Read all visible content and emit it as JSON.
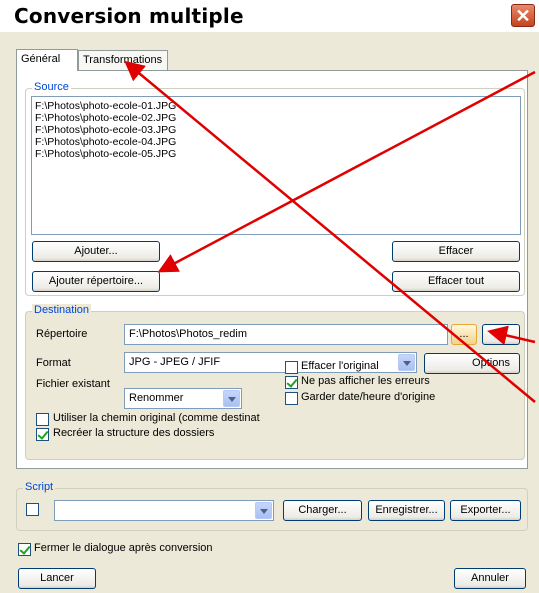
{
  "window": {
    "title": "Conversion multiple",
    "close_glyph": "✕"
  },
  "tabs": [
    {
      "label": "Général"
    },
    {
      "label": "Transformations"
    }
  ],
  "source": {
    "legend": "Source",
    "files": [
      "F:\\Photos\\photo-ecole-01.JPG",
      "F:\\Photos\\photo-ecole-02.JPG",
      "F:\\Photos\\photo-ecole-03.JPG",
      "F:\\Photos\\photo-ecole-04.JPG",
      "F:\\Photos\\photo-ecole-05.JPG"
    ],
    "add_label": "Ajouter...",
    "add_dir_label": "Ajouter répertoire...",
    "clear_label": "Effacer",
    "clear_all_label": "Effacer tout"
  },
  "destination": {
    "legend": "Destination",
    "dir_label": "Répertoire",
    "dir_value": "F:\\Photos\\Photos_redim",
    "browse_label": "...",
    "format_label": "Format",
    "format_value": "JPG - JPEG / JFIF",
    "options_label": "Options",
    "existing_label": "Fichier existant",
    "existing_value": "Renommer",
    "delete_original_label": "Effacer l'original",
    "delete_original_checked": false,
    "hide_errors_label": "Ne pas afficher les erreurs",
    "hide_errors_checked": true,
    "keep_date_label": "Garder date/heure d'origine",
    "keep_date_checked": false,
    "use_original_path_label": "Utiliser la chemin original (comme destinat",
    "use_original_path_checked": false,
    "recreate_structure_label": "Recréer la structure des dossiers",
    "recreate_structure_checked": true
  },
  "script": {
    "legend": "Script",
    "enabled_checked": false,
    "selected_value": "",
    "load_label": "Charger...",
    "save_label": "Enregistrer...",
    "export_label": "Exporter..."
  },
  "footer": {
    "close_after_label": "Fermer le dialogue après conversion",
    "close_after_checked": true,
    "run_label": "Lancer",
    "cancel_label": "Annuler"
  },
  "colors": {
    "annotation_arrow": "#e00000",
    "legend_text": "#0046d5",
    "title_bar": "#ffffff"
  }
}
